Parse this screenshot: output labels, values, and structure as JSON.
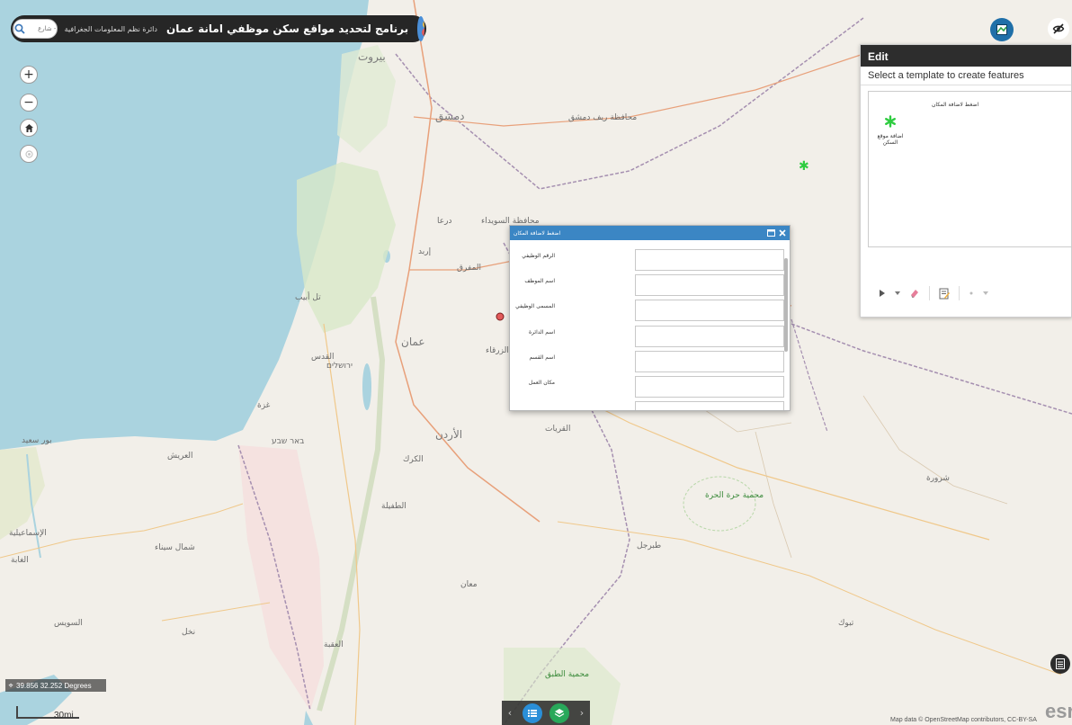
{
  "header": {
    "title": "برنامج لتحديد مواقع سكن موظفي امانة عمان",
    "subtitle": "دائرة نظم المعلومات الجغرافية",
    "search_placeholder": "البحث عن منطقة - حي- شارع"
  },
  "map_controls": {
    "zoom_in": "+",
    "zoom_out": "−"
  },
  "edit_panel": {
    "title": "Edit",
    "instruction": "Select a template to create features",
    "template_group": "اضغط لاضافة المكان",
    "template_item": "اضافة موقع السكن"
  },
  "popup": {
    "title": "اضغط لاضافة المكان",
    "fields": [
      {
        "label": "الرقم الوظيفي"
      },
      {
        "label": "اسم الموظف"
      },
      {
        "label": "المسمى الوظيفي"
      },
      {
        "label": "اسم الدائرة"
      },
      {
        "label": "اسم القسم"
      },
      {
        "label": "مكان العمل"
      }
    ]
  },
  "status": {
    "coordinates": "39.856 32.252 Degrees",
    "scale": "30mi",
    "attribution": "Map data © OpenStreetMap contributors, CC-BY-SA",
    "esri": "esri"
  },
  "places": [
    "بيروت",
    "دمشق",
    "محافظة ريف دمشق",
    "عمان",
    "الأردن",
    "القدس",
    "ירושלים",
    "محمية حرة الحرة",
    "محمية الطبق",
    "السويس",
    "العريش",
    "شمال سيناء",
    "بور سعيد",
    "الإسماعيلية",
    "معان",
    "الكرك",
    "الطفيلة",
    "غزة",
    "الزرقاء",
    "المفرق",
    "محافظة السويداء",
    "درعا",
    "إربد",
    "العقبة",
    "تبوك",
    "באר שבע",
    "تل أبيب",
    "الغابة",
    "نخل",
    "القريات",
    "شرورة",
    "طبرجل"
  ],
  "colors": {
    "header_bg": "#262626",
    "popup_header": "#3b86c4",
    "sea": "#aad3df",
    "land": "#f2efe9",
    "marker_green": "#2ecc40"
  }
}
